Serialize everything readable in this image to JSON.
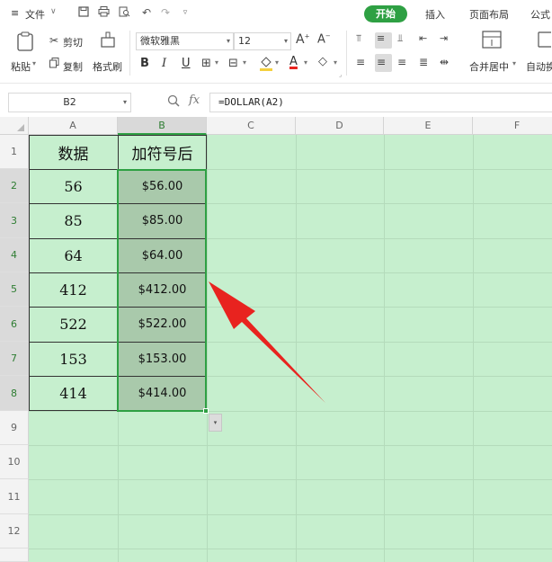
{
  "menubar": {
    "menu_icon": "≡",
    "file_label": "文件",
    "tabs": [
      "开始",
      "插入",
      "页面布局",
      "公式"
    ]
  },
  "ribbon": {
    "paste_label": "粘贴",
    "cut_label": "剪切",
    "copy_label": "复制",
    "format_painter_label": "格式刷",
    "font_name": "微软雅黑",
    "font_size": "12",
    "bold_label": "B",
    "italic_label": "I",
    "underline_label": "U",
    "font_color_label": "A",
    "merge_label": "合并居中",
    "wrap_label": "自动换"
  },
  "formula_bar": {
    "name_box": "B2",
    "fx_label": "fx",
    "formula": "=DOLLAR(A2)"
  },
  "sheet": {
    "columns": [
      "A",
      "B",
      "C",
      "D",
      "E",
      "F"
    ],
    "rows": [
      "1",
      "2",
      "3",
      "4",
      "5",
      "6",
      "7",
      "8",
      "9",
      "10",
      "11",
      "12"
    ],
    "header_a": "数据",
    "header_b": "加符号后",
    "values_a": [
      "56",
      "85",
      "64",
      "412",
      "522",
      "153",
      "414"
    ],
    "values_b": [
      "$56.00",
      "$85.00",
      "$64.00",
      "$412.00",
      "$522.00",
      "$153.00",
      "$414.00"
    ]
  },
  "colors": {
    "accent": "#2ea043",
    "sheet_bg": "#c6efce",
    "selected_fill": "#a9c9ab",
    "arrow": "#e8231f"
  }
}
